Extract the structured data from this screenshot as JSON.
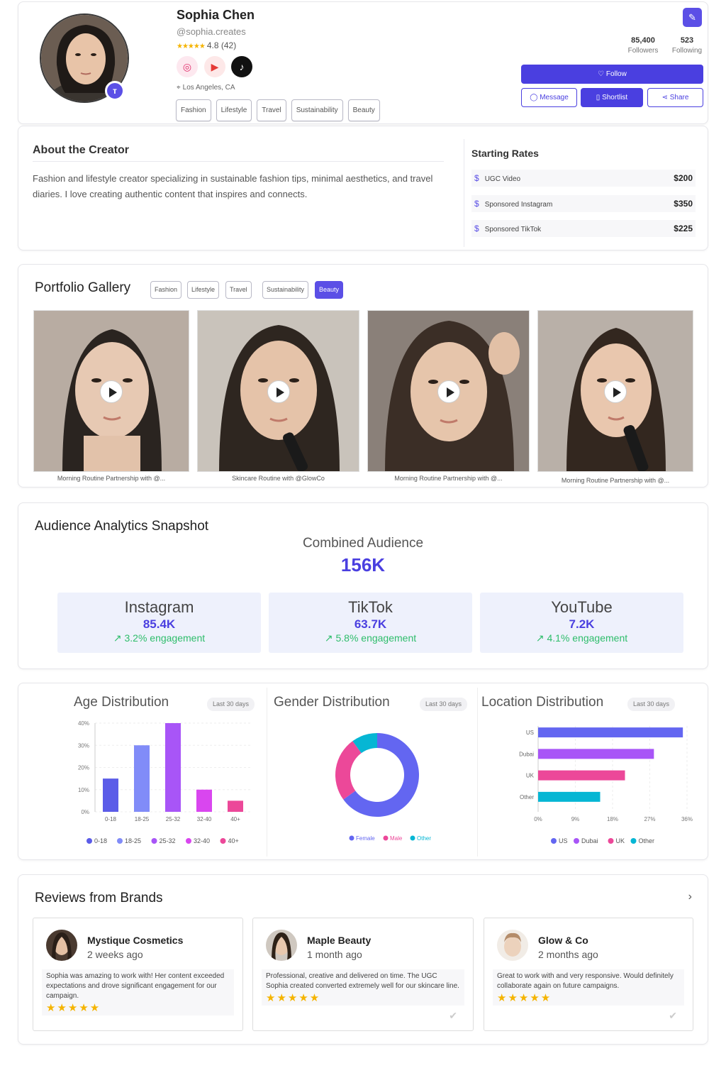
{
  "profile": {
    "name": "Sophia Chen",
    "handle": "@sophia.creates",
    "rating_text": "4.8 (42)",
    "badge": "ᴛ",
    "location": "Los Angeles, CA",
    "tags": [
      "Fashion",
      "Lifestyle",
      "Travel",
      "Sustainability",
      "Beauty"
    ],
    "followers_num": "85,400",
    "followers_lbl": "Followers",
    "following_num": "523",
    "following_lbl": "Following",
    "follow_label": "Follow",
    "message_label": "Message",
    "shortlist_label": "Shortlist",
    "share_label": "Share"
  },
  "about": {
    "title": "About the Creator",
    "text": "Fashion and lifestyle creator specializing in sustainable fashion tips, minimal aesthetics, and travel diaries. I love creating authentic content that inspires and connects."
  },
  "rates": {
    "title": "Starting Rates",
    "items": [
      {
        "label": "UGC Video",
        "price": "$200"
      },
      {
        "label": "Sponsored Instagram",
        "price": "$350"
      },
      {
        "label": "Sponsored TikTok",
        "price": "$225"
      }
    ]
  },
  "portfolio": {
    "title": "Portfolio Gallery",
    "filters": [
      "Fashion",
      "Lifestyle",
      "Travel",
      "Sustainability",
      "Beauty"
    ],
    "captions": [
      "Morning Routine Partnership with @...",
      "Skincare Routine with @GlowCo",
      "Morning Routine Partnership with @...",
      "Morning Routine Partnership with @..."
    ]
  },
  "audience": {
    "title": "Audience Analytics Snapshot",
    "combined_label": "Combined Audience",
    "combined_value": "156K",
    "platforms": [
      {
        "name": "Instagram",
        "value": "85.4K",
        "engagement": "3.2% engagement"
      },
      {
        "name": "TikTok",
        "value": "63.7K",
        "engagement": "5.8% engagement"
      },
      {
        "name": "YouTube",
        "value": "7.2K",
        "engagement": "4.1% engagement"
      }
    ]
  },
  "charts": {
    "period": "Last 30 days",
    "age_title": "Age Distribution",
    "gender_title": "Gender Distribution",
    "location_title": "Location Distribution"
  },
  "chart_data": [
    {
      "type": "bar",
      "title": "Age Distribution",
      "categories": [
        "0-18",
        "18-25",
        "25-32",
        "32-40",
        "40+"
      ],
      "values": [
        15,
        30,
        40,
        10,
        5
      ],
      "ylim": [
        0,
        40
      ],
      "yticks": [
        "0%",
        "10%",
        "20%",
        "30%",
        "40%"
      ],
      "colors": [
        "#5b5ce8",
        "#818cf8",
        "#a855f7",
        "#d946ef",
        "#ec4899"
      ],
      "legend": [
        "0-18",
        "18-25",
        "25-32",
        "32-40",
        "40+"
      ]
    },
    {
      "type": "pie",
      "title": "Gender Distribution",
      "labels": [
        "Female",
        "Male",
        "Other"
      ],
      "values": [
        65,
        25,
        10
      ],
      "colors": [
        "#6366f1",
        "#ec4899",
        "#06b6d4"
      ]
    },
    {
      "type": "bar",
      "orientation": "horizontal",
      "title": "Location Distribution",
      "categories": [
        "US",
        "Dubai",
        "UK",
        "Other"
      ],
      "values": [
        35,
        28,
        21,
        15
      ],
      "xlim": [
        0,
        36
      ],
      "xticks": [
        "0%",
        "9%",
        "18%",
        "27%",
        "36%"
      ],
      "colors": [
        "#6366f1",
        "#a855f7",
        "#ec4899",
        "#06b6d4"
      ],
      "legend": [
        "US",
        "Dubai",
        "UK",
        "Other"
      ]
    }
  ],
  "reviews": {
    "title": "Reviews from Brands",
    "items": [
      {
        "brand": "Mystique Cosmetics",
        "time": "2 weeks ago",
        "text": "Sophia was amazing to work with! Her content exceeded expectations and drove significant engagement for our campaign.",
        "stars": "★★★★★"
      },
      {
        "brand": "Maple Beauty",
        "time": "1 month ago",
        "text": "Professional, creative and delivered on time. The UGC Sophia created converted extremely well for our skincare line.",
        "stars": "★★★★★"
      },
      {
        "brand": "Glow & Co",
        "time": "2 months ago",
        "text": "Great to work with and very responsive. Would definitely collaborate again on future campaigns.",
        "stars": "★★★★★"
      }
    ]
  },
  "colors": {
    "accent": "#4a3fe0",
    "positive": "#2ebd6b",
    "star": "#f5b400"
  }
}
